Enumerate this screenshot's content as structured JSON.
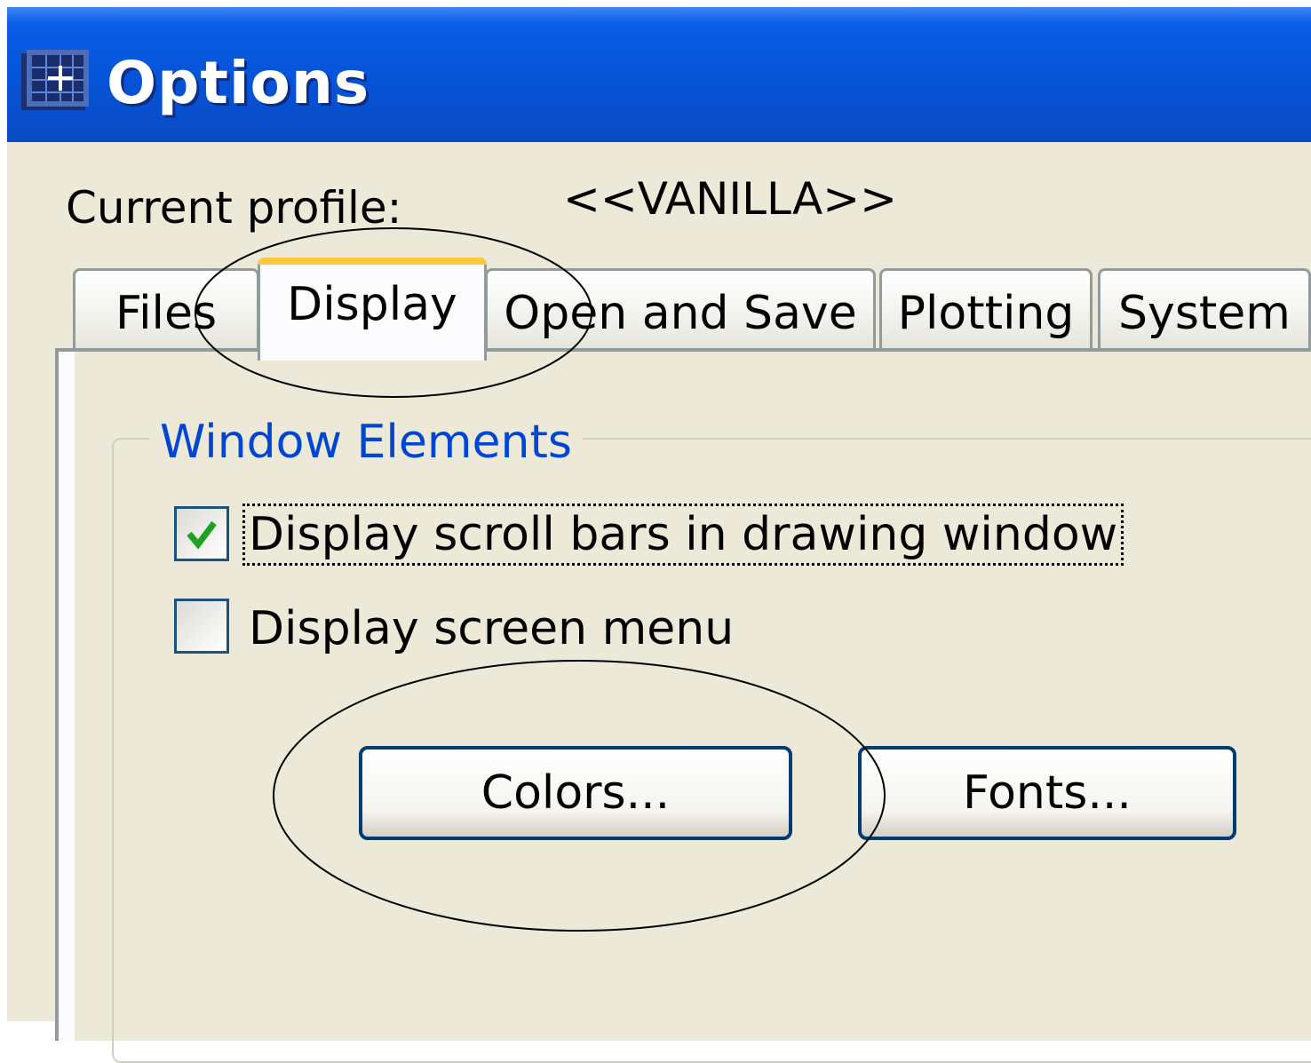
{
  "window": {
    "title": "Options"
  },
  "profile": {
    "label": "Current profile:",
    "value": "<<VANILLA>>"
  },
  "tabs": [
    {
      "label": "Files",
      "active": false
    },
    {
      "label": "Display",
      "active": true
    },
    {
      "label": "Open and Save",
      "active": false
    },
    {
      "label": "Plotting",
      "active": false
    },
    {
      "label": "System",
      "active": false
    }
  ],
  "window_elements": {
    "title": "Window Elements",
    "scroll_bars": {
      "label": "Display scroll bars in drawing window",
      "checked": true
    },
    "screen_menu": {
      "label": "Display screen menu",
      "checked": false
    },
    "colors_button": "Colors...",
    "fonts_button": "Fonts..."
  },
  "colors": {
    "titlebar": "#0653d6",
    "group_title": "#0046d5",
    "active_tab_accent": "#ffc83c",
    "check": "#21a121"
  }
}
